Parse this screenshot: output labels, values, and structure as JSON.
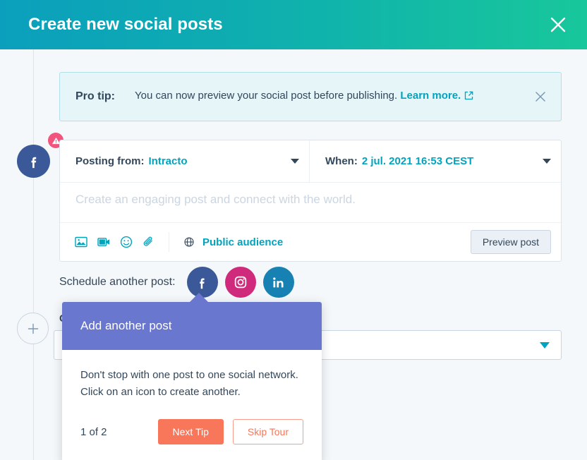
{
  "header": {
    "title": "Create new social posts",
    "close_label": "Close",
    "gradient_from": "#0b9fbd",
    "gradient_to": "#18c79b"
  },
  "protip": {
    "label": "Pro tip:",
    "text": "You can now preview your social post before publishing.",
    "link_label": "Learn more.",
    "link_color": "#00a4bd",
    "close_label": "Dismiss"
  },
  "post": {
    "posting_from_label": "Posting from:",
    "posting_from_value": "Intracto",
    "when_label": "When:",
    "when_value": "2 jul. 2021 16:53 CEST",
    "composer_placeholder": "Create an engaging post and connect with the world.",
    "composer_value": "",
    "toolbar_icons": [
      "image-icon",
      "video-icon",
      "emoji-icon",
      "attachment-icon"
    ],
    "audience_icon": "globe-icon",
    "audience_label": "Public audience",
    "preview_label": "Preview post",
    "network": "facebook",
    "warning_badge": "warning-icon"
  },
  "schedule": {
    "label": "Schedule another post:",
    "networks": [
      {
        "name": "facebook",
        "glyph": "f",
        "color": "#3b5998"
      },
      {
        "name": "instagram",
        "glyph": "",
        "color": "#cf2a7c"
      },
      {
        "name": "linkedin",
        "glyph": "in",
        "color": "#1681b2"
      }
    ],
    "add_post_label": "+"
  },
  "campaign": {
    "label": "Ca",
    "value": "",
    "caret_color": "#00a4bd"
  },
  "tour": {
    "title": "Add another post",
    "line1": "Don't stop with one post to one social network.",
    "line2": "Click on an icon to create another.",
    "counter": "1 of 2",
    "next_label": "Next Tip",
    "skip_label": "Skip Tour",
    "header_color": "#6a77cf",
    "accent_color": "#f8765a"
  }
}
